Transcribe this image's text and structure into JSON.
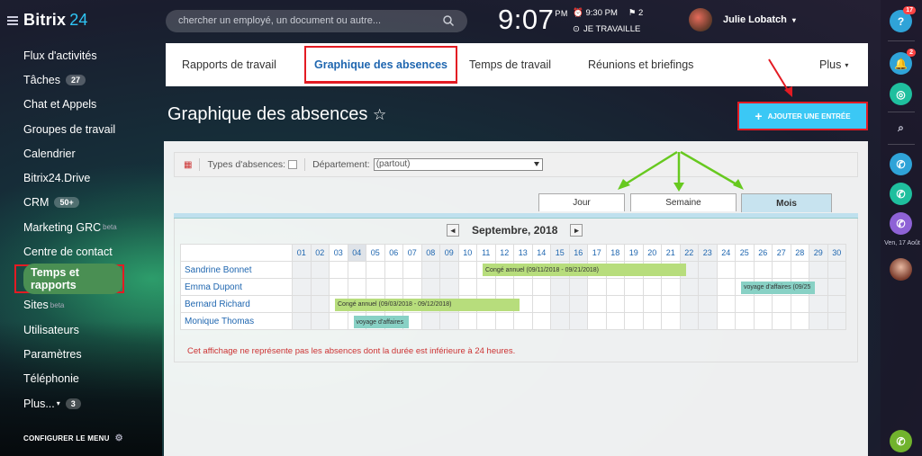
{
  "logo": {
    "brand": "Bitrix",
    "num": "24"
  },
  "menu": [
    {
      "label": "Flux d'activités"
    },
    {
      "label": "Tâches",
      "count": "27"
    },
    {
      "label": "Chat et Appels"
    },
    {
      "label": "Groupes de travail"
    },
    {
      "label": "Calendrier"
    },
    {
      "label": "Bitrix24.Drive"
    },
    {
      "label": "CRM",
      "count": "50+"
    },
    {
      "label": "Marketing GRC",
      "sup": "beta"
    },
    {
      "label": "Centre de contact"
    },
    {
      "label": "Temps et rapports"
    },
    {
      "label": "Sites",
      "sup": "beta"
    },
    {
      "label": "Utilisateurs"
    },
    {
      "label": "Paramètres"
    },
    {
      "label": "Téléphonie"
    },
    {
      "label": "Plus...",
      "count": "3"
    }
  ],
  "configure_label": "CONFIGURER LE MENU",
  "header": {
    "search_placeholder": "chercher un employé, un document ou autre...",
    "time": "9:07",
    "ampm": "PM",
    "alarm": "9:30 PM",
    "flag_count": "2",
    "status": "JE TRAVAILLE",
    "user_name": "Julie Lobatch"
  },
  "right_bar": {
    "help_badge": "17",
    "bell_badge": "2",
    "date": "Ven, 17 Août"
  },
  "tabs": [
    {
      "label": "Rapports de travail"
    },
    {
      "label": "Graphique des absences"
    },
    {
      "label": "Temps de travail"
    },
    {
      "label": "Réunions et briefings"
    },
    {
      "label": "Plus"
    }
  ],
  "page_title": "Graphique des absences",
  "add_button": "AJOUTER UNE ENTRÉE",
  "toolbar": {
    "types_label": "Types d'absences:",
    "department_label": "Département:",
    "department_value": "(partout)"
  },
  "view_tabs": [
    {
      "label": "Jour"
    },
    {
      "label": "Semaine"
    },
    {
      "label": "Mois"
    }
  ],
  "calendar": {
    "month": "Septembre, 2018",
    "days": [
      "01",
      "02",
      "03",
      "04",
      "05",
      "06",
      "07",
      "08",
      "09",
      "10",
      "11",
      "12",
      "13",
      "14",
      "15",
      "16",
      "17",
      "18",
      "19",
      "20",
      "21",
      "22",
      "23",
      "24",
      "25",
      "26",
      "27",
      "28",
      "29",
      "30"
    ],
    "employees": [
      "Sandrine Bonnet",
      "Emma Dupont",
      "Bernard Richard",
      "Monique Thomas"
    ],
    "absences": [
      {
        "employee": "Sandrine Bonnet",
        "label": "Congé annuel (09/11/2018 - 09/21/2018)",
        "start": 11,
        "end": 21,
        "type": "annual"
      },
      {
        "employee": "Emma Dupont",
        "label": "voyage d'affaires (09/25",
        "start": 25,
        "end": 28,
        "type": "trip"
      },
      {
        "employee": "Bernard Richard",
        "label": "Congé annuel (09/03/2018 - 09/12/2018)",
        "start": 3,
        "end": 12,
        "type": "annual"
      },
      {
        "employee": "Monique Thomas",
        "label": "voyage d'affaires",
        "start": 4,
        "end": 6,
        "type": "trip"
      }
    ],
    "note": "Cet affichage ne représente pas les absences dont la durée est inférieure à 24 heures."
  },
  "colors": {
    "accent": "#2fc6f6",
    "annual": "#b7dd7c",
    "trip": "#88d1c5",
    "highlight": "#e31b23"
  }
}
